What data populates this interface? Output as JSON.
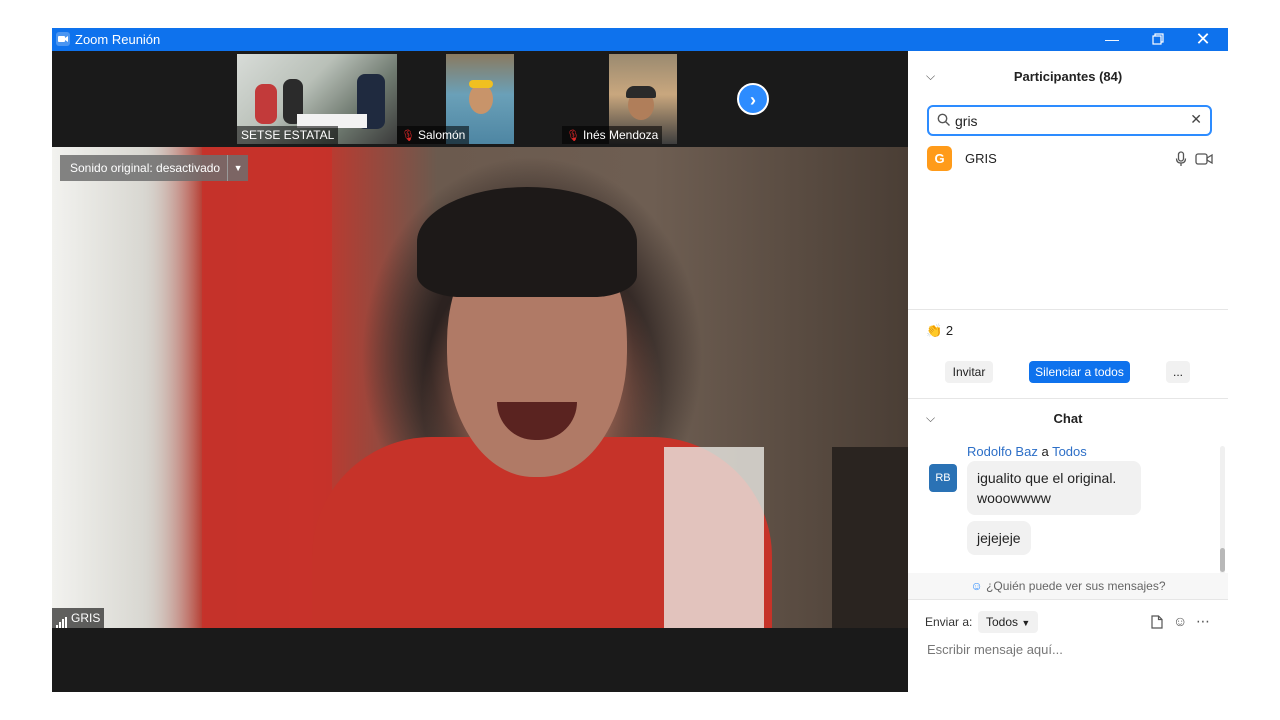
{
  "window": {
    "title": "Zoom Reunión",
    "titlebar_color": "#0e72ed"
  },
  "video_strip": {
    "thumbnails": [
      {
        "name": "SETSE ESTATAL",
        "muted": false
      },
      {
        "name": "Salomón",
        "muted": true
      },
      {
        "name": "Inés Mendoza",
        "muted": true
      }
    ],
    "next_icon": "chevron-right-icon"
  },
  "main_video": {
    "sound_chip": "Sonido original: desactivado",
    "speaker_name": "GRIS"
  },
  "participants": {
    "header": "Participantes (84)",
    "search_value": "gris",
    "list": [
      {
        "initial": "G",
        "name": "GRIS",
        "avatar_color": "#ff9b1a"
      }
    ],
    "reactions": {
      "emoji": "👏",
      "count": "2"
    },
    "buttons": {
      "invite": "Invitar",
      "mute_all": "Silenciar a todos",
      "more": "..."
    }
  },
  "chat": {
    "header": "Chat",
    "sender": "Rodolfo Baz",
    "connector": "a",
    "recipient": "Todos",
    "sender_initials": "RB",
    "messages": [
      "igualito que el original. wooowwww",
      "jejejeje"
    ],
    "who_can_see": "¿Quién puede ver sus mensajes?",
    "send_to_label": "Enviar a:",
    "send_to_value": "Todos",
    "input_placeholder": "Escribir mensaje aquí..."
  }
}
